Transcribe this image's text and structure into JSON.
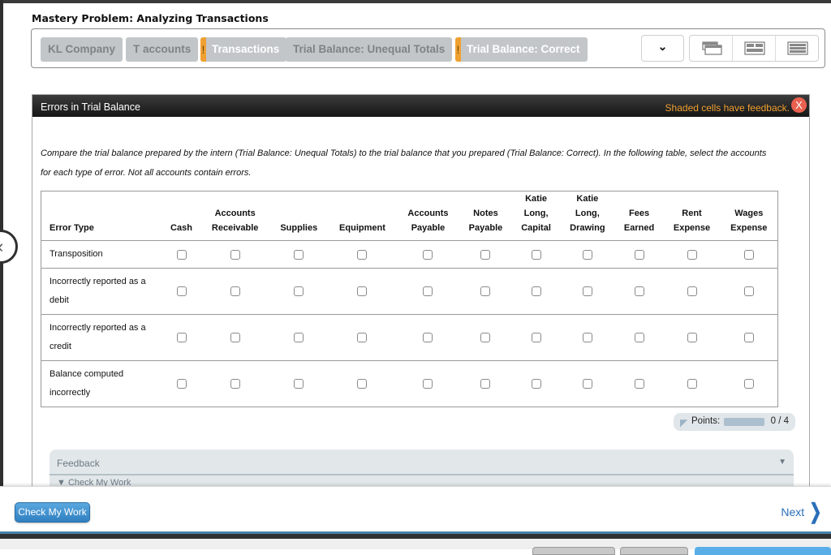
{
  "page": {
    "title": "Mastery Problem: Analyzing Transactions"
  },
  "tabs": [
    {
      "label": "KL Company",
      "warning": false
    },
    {
      "label": "T accounts",
      "warning": false
    },
    {
      "label": "Transactions",
      "warning": true
    },
    {
      "label": "Trial Balance: Unequal Totals",
      "warning": false
    },
    {
      "label": "Trial Balance: Correct",
      "warning": true
    }
  ],
  "toolbar": {
    "dropdown_icon": "chevron-down-icon",
    "view_buttons": [
      "cascade-view-icon",
      "split-view-icon",
      "list-view-icon"
    ]
  },
  "panel": {
    "title": "Errors in Trial Balance",
    "feedback_note": "Shaded cells have feedback.",
    "close_label": "X",
    "instructions": "Compare the trial balance prepared by the intern (Trial Balance: Unequal Totals) to the trial balance that you prepared (Trial Balance: Correct). In the following table, select the accounts for each type of error. Not all accounts contain errors."
  },
  "table": {
    "headers": [
      [
        "Error Type"
      ],
      [
        "Cash"
      ],
      [
        "Accounts",
        "Receivable"
      ],
      [
        "Supplies"
      ],
      [
        "Equipment"
      ],
      [
        "Accounts",
        "Payable"
      ],
      [
        "Notes",
        "Payable"
      ],
      [
        "Katie",
        "Long,",
        "Capital"
      ],
      [
        "Katie",
        "Long,",
        "Drawing"
      ],
      [
        "Fees",
        "Earned"
      ],
      [
        "Rent",
        "Expense"
      ],
      [
        "Wages",
        "Expense"
      ]
    ],
    "rows": [
      {
        "label": "Transposition",
        "checked": [
          false,
          false,
          false,
          false,
          false,
          false,
          false,
          false,
          false,
          false,
          false
        ]
      },
      {
        "label": "Incorrectly reported as a debit",
        "checked": [
          false,
          false,
          false,
          false,
          false,
          false,
          false,
          false,
          false,
          false,
          false
        ]
      },
      {
        "label": "Incorrectly reported as a credit",
        "checked": [
          false,
          false,
          false,
          false,
          false,
          false,
          false,
          false,
          false,
          false,
          false
        ]
      },
      {
        "label": "Balance computed incorrectly",
        "checked": [
          false,
          false,
          false,
          false,
          false,
          false,
          false,
          false,
          false,
          false,
          false
        ]
      }
    ]
  },
  "points": {
    "label": "Points:",
    "earned": 0,
    "possible": 4,
    "display": "0 / 4"
  },
  "feedback": {
    "title": "Feedback",
    "sub_label": "Check My Work"
  },
  "footer": {
    "check_label": "Check My Work",
    "next_label": "Next"
  },
  "colors": {
    "warning": "#f0a030",
    "accent": "#2f7fc0",
    "close": "#e9604e"
  }
}
